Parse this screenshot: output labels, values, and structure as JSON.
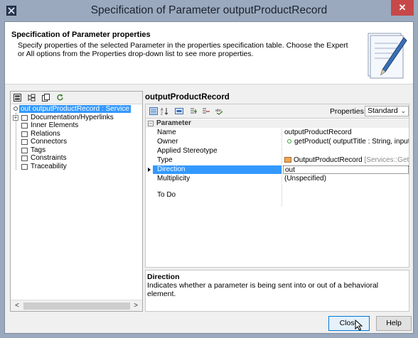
{
  "window": {
    "title": "Specification of Parameter outputProductRecord",
    "close_glyph": "✕"
  },
  "header": {
    "title": "Specification of Parameter properties",
    "description": "Specify properties of the selected Parameter in the properties specification table. Choose the Expert or All options from the Properties drop-down list to see more properties."
  },
  "tree": {
    "root_label": "out outputProductRecord : Service",
    "items": [
      {
        "label": "Documentation/Hyperlinks",
        "expandable": true
      },
      {
        "label": "Inner Elements"
      },
      {
        "label": "Relations"
      },
      {
        "label": "Connectors"
      },
      {
        "label": "Tags"
      },
      {
        "label": "Constraints"
      },
      {
        "label": "Traceability"
      }
    ]
  },
  "right": {
    "title": "outputProductRecord",
    "properties_label": "Properties:",
    "properties_value": "Standard",
    "group": "Parameter",
    "rows": [
      {
        "name": "Name",
        "value": "outputProductRecord"
      },
      {
        "name": "Owner",
        "value": "getProduct( outputTitle : String, input..."
      },
      {
        "name": "Applied Stereotype",
        "value": ""
      },
      {
        "name": "Type",
        "value": "OutputProductRecord",
        "value_extra": "[Services::GetP..."
      },
      {
        "name": "Direction",
        "value": "out"
      },
      {
        "name": "Multiplicity",
        "value": "(Unspecified)"
      },
      {
        "name": "To Do",
        "value": ""
      }
    ]
  },
  "description": {
    "title": "Direction",
    "text": "Indicates whether a parameter is being sent into or out of a behavioral element."
  },
  "buttons": {
    "close": "Close",
    "help": "Help"
  },
  "colors": {
    "titlebar": "#9aa9bd",
    "selection": "#3399ff",
    "close_button": "#c74848"
  }
}
